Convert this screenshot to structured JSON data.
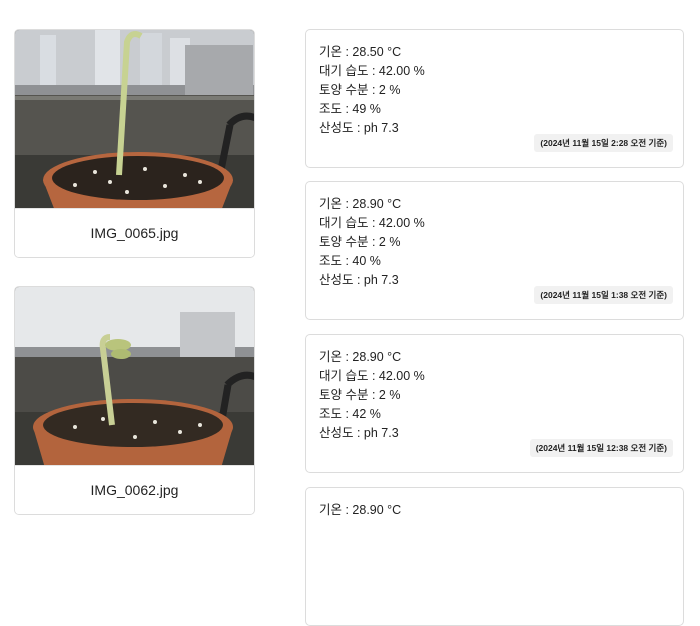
{
  "photos": [
    {
      "filename": "IMG_0065.jpg"
    },
    {
      "filename": "IMG_0062.jpg"
    }
  ],
  "readings": [
    {
      "temperature": "기온 : 28.50 °C",
      "humidity": "대기 습도 : 42.00 %",
      "soil_moisture": "토양 수분 : 2 %",
      "illuminance": "조도 : 49 %",
      "acidity": "산성도 : ph 7.3",
      "timestamp": "(2024년 11월 15일 2:28 오전 기준)"
    },
    {
      "temperature": "기온 : 28.90 °C",
      "humidity": "대기 습도 : 42.00 %",
      "soil_moisture": "토양 수분 : 2 %",
      "illuminance": "조도 : 40 %",
      "acidity": "산성도 : ph 7.3",
      "timestamp": "(2024년 11월 15일 1:38 오전 기준)"
    },
    {
      "temperature": "기온 : 28.90 °C",
      "humidity": "대기 습도 : 42.00 %",
      "soil_moisture": "토양 수분 : 2 %",
      "illuminance": "조도 : 42 %",
      "acidity": "산성도 : ph 7.3",
      "timestamp": "(2024년 11월 15일 12:38 오전 기준)"
    },
    {
      "temperature": "기온 : 28.90 °C"
    }
  ]
}
